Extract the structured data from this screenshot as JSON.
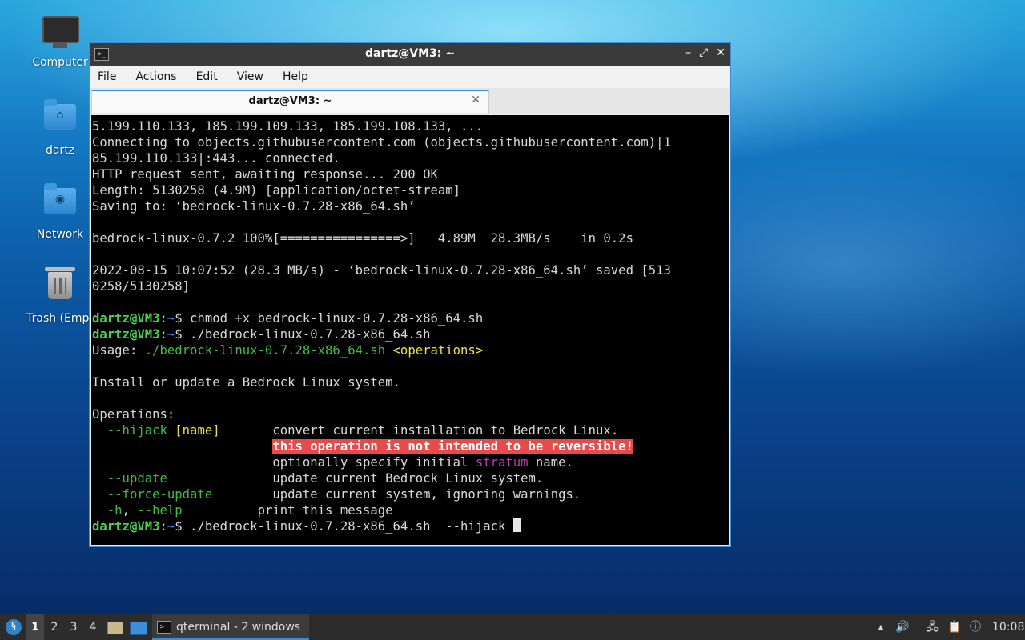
{
  "desktop": {
    "icons": [
      {
        "label": "Computer",
        "icon": "computer-icon"
      },
      {
        "label": "dartz",
        "icon": "home-folder-icon"
      },
      {
        "label": "Network",
        "icon": "network-folder-icon"
      },
      {
        "label": "Trash (Empt",
        "icon": "trash-icon"
      }
    ]
  },
  "window": {
    "title": "dartz@VM3: ~",
    "controls": {
      "minimize": "–",
      "maximize": "⤢",
      "close": "✕"
    },
    "menu": [
      "File",
      "Actions",
      "Edit",
      "View",
      "Help"
    ],
    "tab": {
      "label": "dartz@VM3: ~",
      "close": "✕"
    }
  },
  "terminal": {
    "lines": [
      "5.199.110.133, 185.199.109.133, 185.199.108.133, ...",
      "Connecting to objects.githubusercontent.com (objects.githubusercontent.com)|1",
      "85.199.110.133|:443... connected.",
      "HTTP request sent, awaiting response... 200 OK",
      "Length: 5130258 (4.9M) [application/octet-stream]",
      "Saving to: ‘bedrock-linux-0.7.28-x86_64.sh’",
      "",
      "bedrock-linux-0.7.2 100%[================>]   4.89M  28.3MB/s    in 0.2s",
      "",
      "2022-08-15 10:07:52 (28.3 MB/s) - ‘bedrock-linux-0.7.28-x86_64.sh’ saved [513",
      "0258/5130258]",
      ""
    ],
    "prompt_user": "dartz@VM3",
    "prompt_sep": ":",
    "prompt_dir": "~",
    "prompt_end": "$",
    "cmd1": " chmod +x bedrock-linux-0.7.28-x86_64.sh",
    "cmd2": " ./bedrock-linux-0.7.28-x86_64.sh",
    "usage_label": "Usage: ",
    "usage_script": "./bedrock-linux-0.7.28-x86_64.sh",
    "usage_ops": "<operations>",
    "description": "Install or update a Bedrock Linux system.",
    "operations_header": "Operations:",
    "ops": {
      "hijack_flag": "  --hijack",
      "hijack_arg": "[name]",
      "hijack_desc": "convert current installation to Bedrock Linux.",
      "hijack_warn": "this operation is not intended to be reversible!",
      "hijack_opt_pre": "optionally specify initial ",
      "hijack_opt_word": "stratum",
      "hijack_opt_post": " name.",
      "update_flag": "  --update",
      "update_desc": "update current Bedrock Linux system.",
      "force_flag": "  --force-update",
      "force_desc": "update current system, ignoring warnings.",
      "help_flag_h": "  -h",
      "help_comma": ",",
      "help_flag_long": " --help",
      "help_desc": "print this message"
    },
    "cmd3": " ./bedrock-linux-0.7.28-x86_64.sh  --hijack "
  },
  "taskbar": {
    "desktops": [
      "1",
      "2",
      "3",
      "4"
    ],
    "active_desktop": "1",
    "task_label": "qterminal - 2 windows",
    "clock": "10:08"
  },
  "colors": {
    "prompt_green": "#4ccf4c",
    "prompt_blue": "#4d7bd9",
    "warning_bg": "#e84a4a",
    "accent": "#3b8fd8"
  }
}
